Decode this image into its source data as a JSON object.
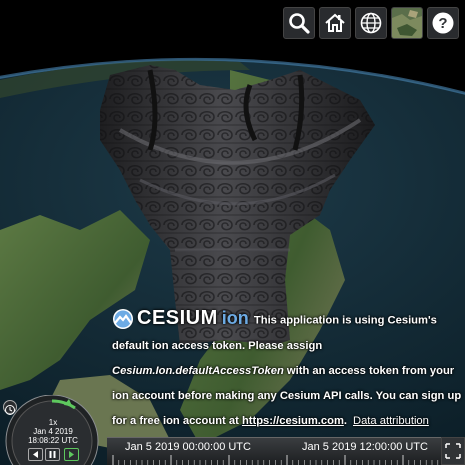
{
  "toolbar": {
    "buttons": [
      {
        "name": "search-icon",
        "label": "Geocoder search"
      },
      {
        "name": "home-icon",
        "label": "View Home"
      },
      {
        "name": "globe-icon",
        "label": "Scene mode picker"
      },
      {
        "name": "imagery-thumbnail-icon",
        "label": "Base layer picker"
      },
      {
        "name": "question-icon",
        "label": "Navigation help"
      }
    ]
  },
  "credit": {
    "logo_main": "CESIUM",
    "logo_ion": "ion",
    "line1": "This application is using Cesium's",
    "line2": "default ion access token. Please assign",
    "token_name": "Cesium.Ion.defaultAccessToken",
    "line3_rest": " with an access token from your",
    "line4": "ion account before making any Cesium API calls. You can sign up",
    "line5_pre": "for a free ion account at ",
    "link": "https://cesium.com",
    "line5_post": ".",
    "data_attribution": "Data attribution"
  },
  "animation": {
    "speed": "1x",
    "date": "Jan 4 2019",
    "time": "18:08:22 UTC"
  },
  "timeline": {
    "labels": [
      "Jan 5 2019 00:00:00 UTC",
      "Jan 5 2019 12:00:00 UTC"
    ]
  },
  "colors": {
    "ocean": "#0f2530",
    "land": "#4f6e3e",
    "ion_blue": "#6dabe4",
    "toolbar_bg": "#303336"
  }
}
